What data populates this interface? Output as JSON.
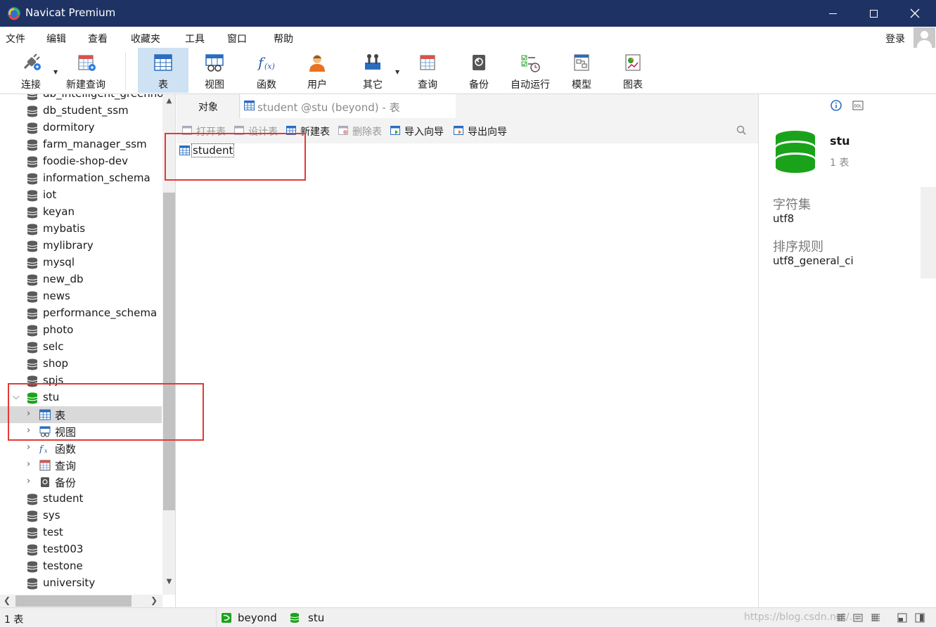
{
  "window": {
    "title": "Navicat Premium"
  },
  "menu": [
    "文件",
    "编辑",
    "查看",
    "收藏夹",
    "工具",
    "窗口",
    "帮助"
  ],
  "login": "登录",
  "toolbar": [
    {
      "label": "连接",
      "icon": "connection-plug-icon"
    },
    {
      "label": "新建查询",
      "icon": "new-query-icon"
    },
    {
      "label": "表",
      "icon": "table-icon",
      "active": true
    },
    {
      "label": "视图",
      "icon": "view-icon"
    },
    {
      "label": "函数",
      "icon": "function-fx-icon"
    },
    {
      "label": "用户",
      "icon": "user-icon"
    },
    {
      "label": "其它",
      "icon": "tools-icon"
    },
    {
      "label": "查询",
      "icon": "query-icon"
    },
    {
      "label": "备份",
      "icon": "backup-icon"
    },
    {
      "label": "自动运行",
      "icon": "auto-run-icon"
    },
    {
      "label": "模型",
      "icon": "model-icon"
    },
    {
      "label": "图表",
      "icon": "chart-icon"
    }
  ],
  "tree": {
    "clipped_top": "db_intelligent_greenho",
    "databases_before": [
      "db_student_ssm",
      "dormitory",
      "farm_manager_ssm",
      "foodie-shop-dev",
      "information_schema",
      "iot",
      "keyan",
      "mybatis",
      "mylibrary",
      "mysql",
      "new_db",
      "news",
      "performance_schema",
      "photo",
      "selc",
      "shop",
      "spjs"
    ],
    "open_db": "stu",
    "open_db_children": [
      {
        "label": "表",
        "icon": "table-icon",
        "selected": true
      },
      {
        "label": "视图",
        "icon": "view-icon"
      },
      {
        "label": "函数",
        "icon": "function-fx-icon"
      },
      {
        "label": "查询",
        "icon": "query-icon"
      },
      {
        "label": "备份",
        "icon": "backup-icon"
      }
    ],
    "databases_after": [
      "student",
      "sys",
      "test",
      "test003",
      "testone",
      "university"
    ]
  },
  "tabs": {
    "objects": "对象",
    "doc": "student @stu (beyond) - 表"
  },
  "object_toolbar": [
    {
      "label": "打开表",
      "disabled": true
    },
    {
      "label": "设计表",
      "disabled": true
    },
    {
      "label": "新建表",
      "disabled": false
    },
    {
      "label": "删除表",
      "disabled": true
    },
    {
      "label": "导入向导",
      "disabled": false
    },
    {
      "label": "导出向导",
      "disabled": false
    }
  ],
  "objects": [
    "student"
  ],
  "info": {
    "name": "stu",
    "count": "1 表",
    "charset_label": "字符集",
    "charset_value": "utf8",
    "collation_label": "排序规则",
    "collation_value": "utf8_general_ci"
  },
  "status": {
    "left": "1 表",
    "connection": "beyond",
    "database": "stu",
    "watermark": "https://blog.csdn.net/..."
  },
  "colors": {
    "titlebar": "#1e3363",
    "db_green": "#1aa31a",
    "active_tool": "#cfe2f3",
    "annotation_red": "#e53935"
  }
}
